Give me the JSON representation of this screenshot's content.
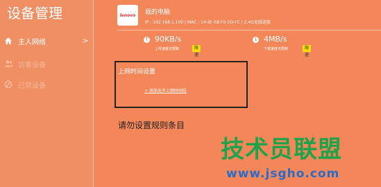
{
  "app_title": "设备管理",
  "sidebar": {
    "items": [
      {
        "label": "主人网络",
        "icon": "home-icon",
        "chevron": ">"
      },
      {
        "label": "访客设备",
        "icon": "users-icon"
      },
      {
        "label": "已禁设备",
        "icon": "block-icon"
      }
    ]
  },
  "device": {
    "logo_text": "lenovo",
    "name": "我的电脑",
    "info": "IP : 192.168.1.100 | MAC : 14-9F-E8-F0-2D-FC | 2.4G无线连接"
  },
  "speeds": {
    "upload": {
      "value": "90KB/s",
      "desc": "上传速度无限制",
      "button": "限速",
      "icon": "arrow-up-icon"
    },
    "download": {
      "value": "4MB/s",
      "desc": "下载速度无限制",
      "button": "限速",
      "icon": "arrow-down-icon"
    }
  },
  "time_panel": {
    "title": "上网时间设置",
    "link": "+ 添加允许上网时间段"
  },
  "empty_message": "请勿设置规则条目",
  "watermark": {
    "title": "技术员联盟",
    "url": "www.jsgho.com"
  },
  "colors": {
    "background": "#f4875a",
    "highlight_button": "#f7e000",
    "watermark_green": "#1fa34a",
    "watermark_blue": "#2a6bc9"
  }
}
